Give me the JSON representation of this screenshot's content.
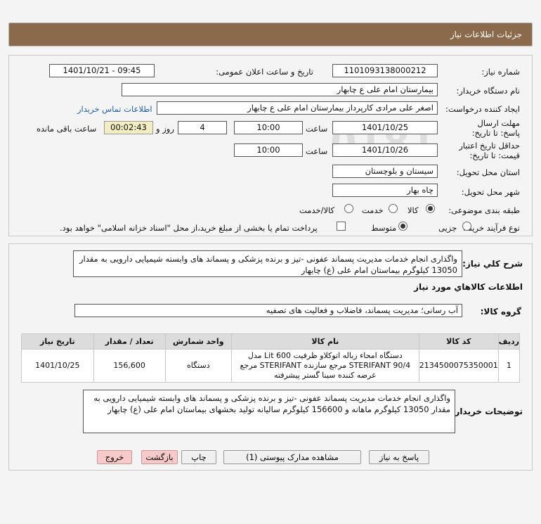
{
  "header": {
    "title": "جزئیات اطلاعات نیاز"
  },
  "form": {
    "need_number_label": "شماره نیاز:",
    "need_number": "1101093138000212",
    "announce_label": "تاریخ و ساعت اعلان عمومی:",
    "announce_value": "1401/10/21 - 09:45",
    "buyer_org_label": "نام دستگاه خریدار:",
    "buyer_org": "بیمارستان امام علی  ع  چابهار",
    "creator_label": "ایجاد کننده درخواست:",
    "creator": "اصغر علی مرادی کارپرداز بیمارستان امام علی  ع  چابهار",
    "contact_link": "اطلاعات تماس خریدار",
    "deadline_label": "مهلت ارسال پاسخ: تا تاریخ:",
    "deadline_date": "1401/10/25",
    "time_label": "ساعت",
    "deadline_time": "10:00",
    "days_value": "4",
    "days_label": "روز و",
    "remaining_time": "00:02:43",
    "remaining_label": "ساعت باقی مانده",
    "validity_label": "حداقل تاریخ اعتبار قیمت: تا تاریخ:",
    "validity_date": "1401/10/26",
    "validity_time": "10:00",
    "province_label": "استان محل تحویل:",
    "province": "سیستان و بلوچستان",
    "city_label": "شهر محل تحویل:",
    "city": "چاه بهار",
    "category_label": "طبقه بندی موضوعی:",
    "category_options": [
      "کالا",
      "خدمت",
      "کالا/خدمت"
    ],
    "process_label": "نوع فرآیند خرید :",
    "process_options": [
      "جزیی",
      "متوسط"
    ],
    "treasury_text": "پرداخت تمام یا بخشی از مبلغ خرید،از محل \"اسناد خزانه اسلامی\" خواهد بود."
  },
  "details": {
    "summary_label": "شرح کلي نياز:",
    "summary": "واگذاری انجام خدمات مدیریت پسماند عفونی -تیز و برنده پزشکی و پسماند های وابسته شیمیایی دارویی به مقدار 13050 کیلوگرم  بیماستان امام علی (ع) چابهار",
    "goods_info_title": "اطلاعات کالاهاي مورد نياز",
    "group_label": "گروه کالا:",
    "group_value": "آب رسانی؛ مدیریت پسماند، فاضلاب و فعالیت های تصفیه",
    "table": {
      "headers": [
        "ردیف",
        "کد کالا",
        "نام کالا",
        "واحد شمارش",
        "تعداد / مقدار",
        "تاریخ نیاز"
      ],
      "rows": [
        [
          "1",
          "2134500075350001",
          "دستگاه امحاء زباله اتوکلاو ظرفیت 600 Lit مدل STERIFANT 90/4 مرجع سازنده STERIFANT مرجع عرضه کننده سینا گستر پیشرفته",
          "دستگاه",
          "156,600",
          "1401/10/25"
        ]
      ]
    },
    "buyer_notes_label": "توضیحات خریدار:",
    "buyer_notes": "واگذاری انجام خدمات مدیریت پسماند عفونی -تیز و برنده پزشکی و پسماند های وابسته شیمیایی دارویی به مقدار 13050 کیلوگرم ماهانه و 156600 کیلوگرم سالیانه تولید بخشهای  بیماستان امام علی (ع) چابهار"
  },
  "buttons": {
    "reply": "پاسخ به نیاز",
    "attachments": "مشاهده مدارک پیوستی (1)",
    "print": "چاپ",
    "back": "بازگشت",
    "exit": "خروج"
  },
  "colors": {
    "header": "#8b6a4c",
    "link": "#1b5fb5",
    "exit_button": "#f7c9c9"
  }
}
